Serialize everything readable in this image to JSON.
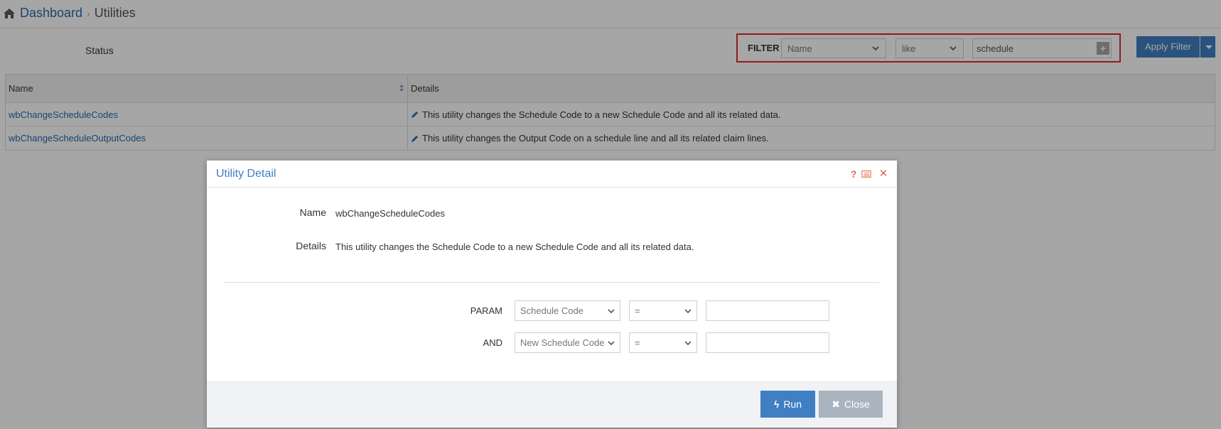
{
  "breadcrumb": {
    "home": "Dashboard",
    "separator": "›",
    "current": "Utilities"
  },
  "toolbar": {
    "status_label": "Status"
  },
  "filter": {
    "label": "FILTER",
    "field_value": "Name",
    "operator_value": "like",
    "text_value": "schedule",
    "add_label": "+"
  },
  "apply_filter": {
    "label": "Apply Filter"
  },
  "grid": {
    "headers": {
      "name": "Name",
      "details": "Details"
    },
    "rows": [
      {
        "name": "wbChangeScheduleCodes",
        "details": "This utility changes the Schedule Code to a new Schedule Code and all its related data."
      },
      {
        "name": "wbChangeScheduleOutputCodes",
        "details": "This utility changes the Output Code on a schedule line and all its related claim lines."
      }
    ]
  },
  "modal": {
    "title": "Utility Detail",
    "help_glyph": "?",
    "close_glyph": "✕",
    "name_label": "Name",
    "name_value": "wbChangeScheduleCodes",
    "details_label": "Details",
    "details_value": "This utility changes the Schedule Code to a new Schedule Code and all its related data.",
    "params": [
      {
        "label": "PARAM",
        "field": "Schedule Code",
        "operator": "=",
        "value": ""
      },
      {
        "label": "AND",
        "field": "New Schedule Code",
        "operator": "=",
        "value": ""
      }
    ],
    "run_label": "Run",
    "run_glyph": "ϟ",
    "close_label": "Close",
    "close_btn_glyph": "✖"
  },
  "colors": {
    "accent": "#3f7fc2",
    "link": "#2a6aa9",
    "danger_icon": "#e06b47",
    "highlight_border": "#e02a2a"
  }
}
